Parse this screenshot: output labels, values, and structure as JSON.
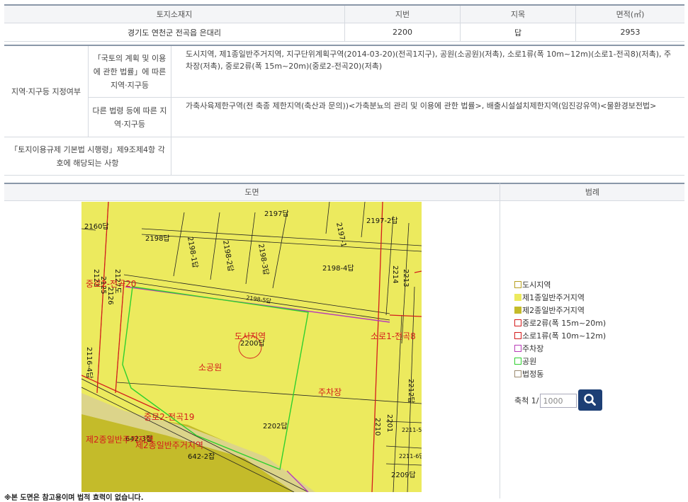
{
  "land_info": {
    "headers": [
      "토지소재지",
      "지번",
      "지목",
      "면적(㎡)"
    ],
    "row": [
      "경기도 연천군 전곡읍 은대리",
      "2200",
      "답",
      "2953"
    ]
  },
  "zoning": {
    "group_label": "지역·지구등 지정여부",
    "rows": [
      {
        "label": "「국토의 계획 및 이용에 관한 법률」에 따른 지역·지구등",
        "value": "도시지역, 제1종일반주거지역, 지구단위계획구역(2014-03-20)(전곡1지구), 공원(소공원)(저촉), 소로1류(폭 10m~12m)(소로1-전곡8)(저촉), 주차장(저촉), 중로2류(폭 15m~20m)(중로2-전곡20)(저촉)"
      },
      {
        "label": "다른 법령 등에 따른 지역·지구등",
        "value": "가축사육제한구역(전 축종 제한지역(축산과 문의))<가축분뇨의 관리 및 이용에 관한 법률>, 배출시설설치제한지역(임진강유역)<물환경보전법>"
      }
    ],
    "enforcement_label": "「토지이용규제 기본법 시행령」제9조제4항 각 호에 해당되는 사항",
    "enforcement_value": ""
  },
  "map_panel": {
    "title": "도면"
  },
  "legend_panel": {
    "title": "범례",
    "items": [
      {
        "label": "도시지역",
        "fill": "#ffffff",
        "border": "#b8a020"
      },
      {
        "label": "제1종일반주거지역",
        "fill": "#ecea5e",
        "border": "#ecea5e"
      },
      {
        "label": "제2종일반주거지역",
        "fill": "#c4bb2a",
        "border": "#c4bb2a"
      },
      {
        "label": "중로2류(폭 15m~20m)",
        "fill": "#ffffff",
        "border": "#d41c1c"
      },
      {
        "label": "소로1류(폭 10m~12m)",
        "fill": "#ffffff",
        "border": "#d41c1c"
      },
      {
        "label": "주차장",
        "fill": "#ffffff",
        "border": "#b83cb8"
      },
      {
        "label": "공원",
        "fill": "#ffffff",
        "border": "#2ed02e"
      },
      {
        "label": "법정동",
        "fill": "#ffffff",
        "border": "#9a8a70"
      }
    ],
    "scale_label": "축척 1/",
    "scale_value": "1000",
    "search_icon": "search-icon"
  },
  "map": {
    "parcels": [
      "2197답",
      "2197-1",
      "2197-2답",
      "2160답",
      "2198답",
      "2198-1답",
      "2198-2답",
      "2198-3답",
      "2198-4답",
      "2198-5답",
      "2200답",
      "2202답",
      "2209답",
      "2212답",
      "2211-5답",
      "2211-6답",
      "642-2잡",
      "642-3잡",
      "2116-4답",
      "2123",
      "2125",
      "2126",
      "2127도",
      "2201",
      "2210",
      "2213",
      "2214"
    ],
    "labels": [
      "도시지역",
      "소공원",
      "주차장",
      "중로2-전곡20",
      "소로1-전곡8",
      "중로2-전곡19",
      "제2종일반주거지역",
      "제2종일반주거지역"
    ]
  },
  "footnote": "※본 도면은 참고용이며 법적 효력이 없습니다."
}
